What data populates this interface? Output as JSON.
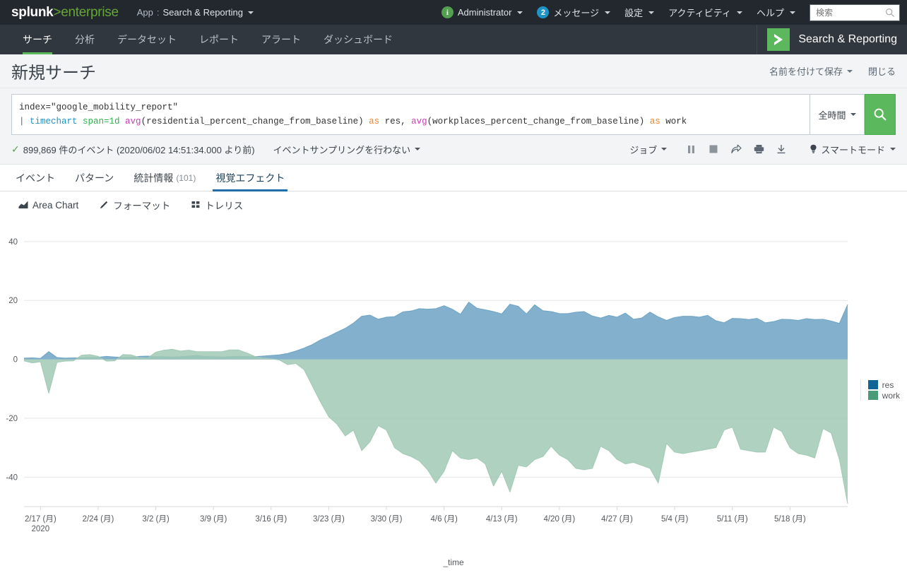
{
  "topbar": {
    "logo_word": "splunk",
    "logo_gt": ">",
    "logo_enterprise": "enterprise",
    "app_label": "App",
    "app_colon": ":",
    "app_name": "Search & Reporting",
    "info_icon": "info-icon",
    "administrator": "Administrator",
    "messages_count": "2",
    "messages": "メッセージ",
    "settings": "設定",
    "activity": "アクティビティ",
    "help": "ヘルプ",
    "search_placeholder": "検索",
    "search_value": "",
    "search_icon": "search-icon"
  },
  "nav": {
    "items": [
      {
        "label": "サーチ",
        "active": true
      },
      {
        "label": "分析",
        "active": false
      },
      {
        "label": "データセット",
        "active": false
      },
      {
        "label": "レポート",
        "active": false
      },
      {
        "label": "アラート",
        "active": false
      },
      {
        "label": "ダッシュボード",
        "active": false
      }
    ],
    "app_icon_glyph": ">",
    "app_title": "Search & Reporting",
    "app_accent": "#5cb85c"
  },
  "page": {
    "title": "新規サーチ",
    "save_as": "名前を付けて保存",
    "close": "閉じる"
  },
  "search": {
    "line1_field": "index=",
    "line1_value": "\"google_mobility_report\"",
    "line2_pipe": "| ",
    "line2_cmd": "timechart",
    "line2_span": " span=1d ",
    "line2_fn1": "avg",
    "line2_arg1": "(residential_percent_change_from_baseline) ",
    "line2_as1": "as",
    "line2_alias1": " res, ",
    "line2_fn2": "avg",
    "line2_arg2": "(workplaces_percent_change_from_baseline) ",
    "line2_as2": "as",
    "line2_alias2": " work",
    "full_query": "index=\"google_mobility_report\"\n| timechart span=1d avg(residential_percent_change_from_baseline) as res, avg(workplaces_percent_change_from_baseline) as work",
    "time_range": "全時間",
    "go_icon": "search-icon",
    "go_color": "#5cb85c"
  },
  "status": {
    "check_icon": "check-icon",
    "event_text": "899,869 件のイベント (2020/06/02 14:51:34.000 より前)",
    "sampling": "イベントサンプリングを行わない",
    "jobs": "ジョブ",
    "pause_icon": "pause-icon",
    "stop_icon": "stop-icon",
    "share_icon": "share-icon",
    "print_icon": "print-icon",
    "export_icon": "export-icon",
    "mode_icon": "lightbulb-icon",
    "mode": "スマートモード"
  },
  "result_tabs": [
    {
      "label": "イベント",
      "count": "",
      "active": false
    },
    {
      "label": "パターン",
      "count": "",
      "active": false
    },
    {
      "label": "統計情報",
      "count": "(101)",
      "active": false
    },
    {
      "label": "視覚エフェクト",
      "count": "",
      "active": true
    }
  ],
  "chart_tools": [
    {
      "label": "Area Chart",
      "icon": "area-chart-icon"
    },
    {
      "label": "フォーマット",
      "icon": "pencil-icon"
    },
    {
      "label": "トレリス",
      "icon": "grid-icon"
    }
  ],
  "chart_data": {
    "type": "area",
    "title": "",
    "xlabel": "_time",
    "ylabel": "",
    "ylim": [
      -50,
      45
    ],
    "yticks": [
      40,
      20,
      0,
      -20,
      -40
    ],
    "grid": true,
    "legend_position": "right",
    "x_axis_year": "2020",
    "xticks": [
      "2/17 (月)",
      "2/24 (月)",
      "3/2 (月)",
      "3/9 (月)",
      "3/16 (月)",
      "3/23 (月)",
      "3/30 (月)",
      "4/6 (月)",
      "4/13 (月)",
      "4/20 (月)",
      "4/27 (月)",
      "5/4 (月)",
      "5/11 (月)",
      "5/18 (月)"
    ],
    "xtick_indices": [
      2,
      9,
      16,
      23,
      30,
      37,
      44,
      51,
      58,
      65,
      72,
      79,
      86,
      93
    ],
    "series": [
      {
        "name": "res",
        "color": "#6da3c4",
        "legend_color": "#0f6595",
        "values": [
          0.4,
          0.5,
          0.3,
          2.6,
          0.6,
          0.4,
          0.5,
          0.5,
          0.6,
          0.7,
          1.0,
          0.8,
          0.6,
          0.7,
          1.0,
          1.1,
          0.9,
          0.9,
          0.8,
          0.9,
          1.1,
          1.3,
          1.0,
          0.9,
          0.8,
          0.9,
          1.0,
          1.0,
          0.9,
          1.1,
          1.3,
          1.5,
          2.0,
          2.8,
          3.8,
          5.0,
          6.6,
          7.8,
          9.2,
          10.5,
          12.3,
          14.6,
          15.0,
          13.6,
          14.3,
          14.5,
          16.1,
          16.4,
          17.2,
          17.0,
          17.2,
          18.2,
          17.0,
          15.3,
          19.4,
          17.3,
          16.8,
          16.2,
          15.4,
          18.7,
          18.0,
          15.4,
          18.5,
          16.5,
          16.2,
          15.5,
          15.5,
          16.0,
          16.2,
          14.7,
          14.0,
          14.9,
          14.3,
          15.7,
          13.6,
          14.0,
          16.0,
          14.4,
          13.2,
          14.2,
          14.6,
          14.6,
          14.3,
          14.9,
          13.1,
          12.4,
          13.9,
          13.8,
          13.5,
          13.9,
          12.4,
          12.8,
          13.6,
          13.5,
          13.2,
          13.8,
          13.5,
          13.6,
          13.0,
          12.2,
          18.6
        ],
        "area_opacity": 0.85
      },
      {
        "name": "work",
        "color": "#a1c9b5",
        "legend_color": "#4a9b78",
        "values": [
          -0.5,
          -1.2,
          -0.8,
          -11.5,
          -1.0,
          -0.6,
          -0.5,
          1.4,
          1.6,
          1.0,
          -0.6,
          -0.5,
          1.6,
          1.5,
          0.6,
          0.4,
          2.4,
          3.1,
          3.4,
          2.8,
          3.1,
          2.6,
          2.6,
          2.6,
          2.6,
          3.2,
          3.2,
          2.2,
          1.0,
          0.4,
          0.2,
          -0.2,
          -1.8,
          -1.4,
          -3.5,
          -9.0,
          -14.5,
          -19.5,
          -22.0,
          -26.0,
          -24.0,
          -31.0,
          -28.0,
          -22.5,
          -24.0,
          -30.0,
          -32.0,
          -33.0,
          -34.5,
          -37.5,
          -42.0,
          -38.0,
          -31.0,
          -33.5,
          -34.0,
          -33.5,
          -35.5,
          -43.0,
          -38.0,
          -45.0,
          -36.0,
          -36.5,
          -34.0,
          -33.0,
          -29.5,
          -32.5,
          -34.0,
          -37.0,
          -37.5,
          -37.0,
          -29.5,
          -31.0,
          -34.0,
          -35.5,
          -35.0,
          -36.0,
          -37.0,
          -42.0,
          -28.5,
          -31.5,
          -32.0,
          -31.5,
          -31.0,
          -30.5,
          -30.0,
          -24.0,
          -23.0,
          -30.5,
          -31.0,
          -31.5,
          -31.5,
          -23.0,
          -24.5,
          -30.0,
          -32.0,
          -32.5,
          -33.5,
          -23.5,
          -25.0,
          -34.0,
          -49.0
        ],
        "area_opacity": 0.85
      }
    ]
  },
  "legend": {
    "items": [
      {
        "label": "res",
        "color": "#0f6595"
      },
      {
        "label": "work",
        "color": "#4a9b78"
      }
    ]
  }
}
